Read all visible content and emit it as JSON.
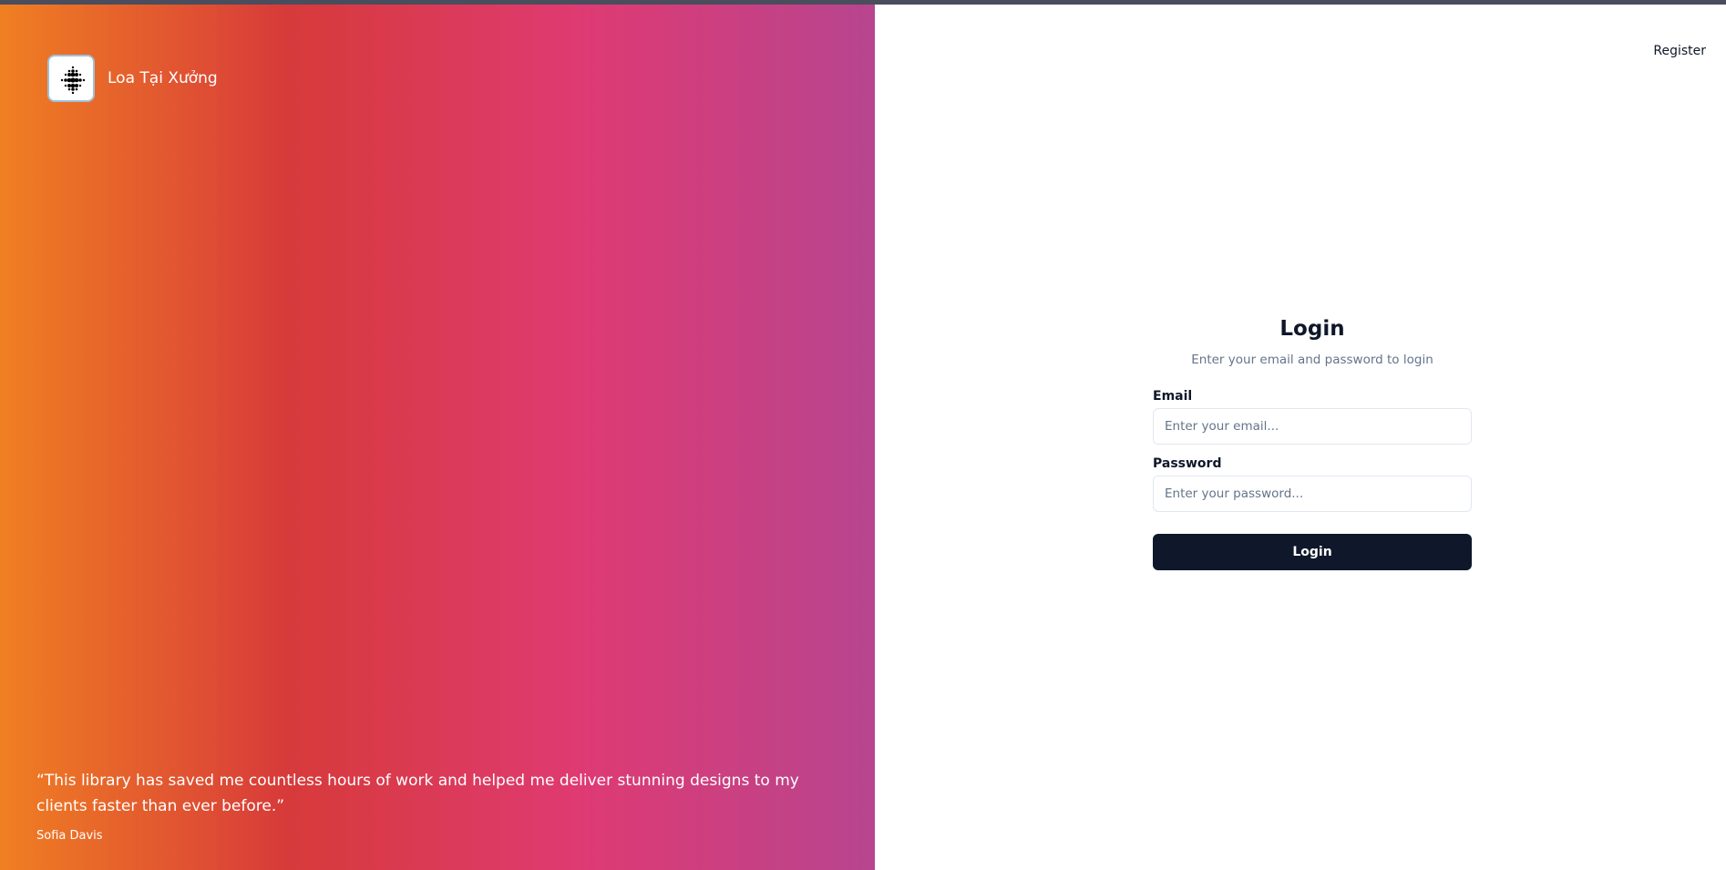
{
  "brand": {
    "name": "Loa Tại Xưởng",
    "logo_icon": "dot-grid-logo-icon"
  },
  "testimonial": {
    "quote": "“This library has saved me countless hours of work and helped me deliver stunning designs to my clients faster than ever before.”",
    "author": "Sofia Davis"
  },
  "header": {
    "register_label": "Register"
  },
  "login_form": {
    "title": "Login",
    "subtitle": "Enter your email and password to login",
    "email": {
      "label": "Email",
      "placeholder": "Enter your email...",
      "value": ""
    },
    "password": {
      "label": "Password",
      "placeholder": "Enter your password...",
      "value": ""
    },
    "submit_label": "Login"
  },
  "colors": {
    "gradient_start": "#f07f22",
    "gradient_mid_1": "#d73a3a",
    "gradient_mid_2": "#df3a72",
    "gradient_end": "#b7458f",
    "primary_button": "#0f172a",
    "muted_text": "#64748b"
  }
}
